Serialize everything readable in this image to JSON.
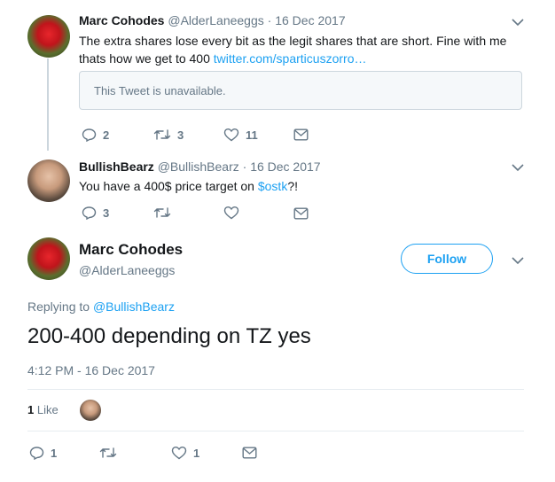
{
  "tweet1": {
    "name": "Marc Cohodes",
    "handle": "@AlderLaneeggs",
    "separator": "·",
    "date": "16 Dec 2017",
    "text_line1": "The extra shares lose every bit as the legit shares that are short. Fine with me",
    "text_line2": "thats how we get to 400",
    "link": "twitter.com/sparticuszorro…",
    "quote_unavailable": "This Tweet is unavailable.",
    "replies": "2",
    "retweets": "3",
    "likes": "11"
  },
  "tweet2": {
    "name": "BullishBearz",
    "handle": "@BullishBearz",
    "separator": "·",
    "date": "16 Dec 2017",
    "text_before": "You have a 400$ price target on ",
    "cashtag": "$ostk",
    "text_after": "?!",
    "replies": "3"
  },
  "main_tweet": {
    "name": "Marc Cohodes",
    "handle": "@AlderLaneeggs",
    "follow_label": "Follow",
    "replying_prefix": "Replying to ",
    "replying_to": "@BullishBearz",
    "text": "200-400 depending on TZ yes",
    "timestamp": "4:12 PM - 16 Dec 2017",
    "like_count": "1",
    "like_label": "Like",
    "replies": "1",
    "likes": "1"
  },
  "colors": {
    "accent": "#1da1f2",
    "muted": "#657786",
    "text": "#14171a",
    "border": "#ccd6dd"
  },
  "icons": [
    "reply-icon",
    "retweet-icon",
    "heart-icon",
    "dm-icon",
    "chevron-down-icon"
  ]
}
